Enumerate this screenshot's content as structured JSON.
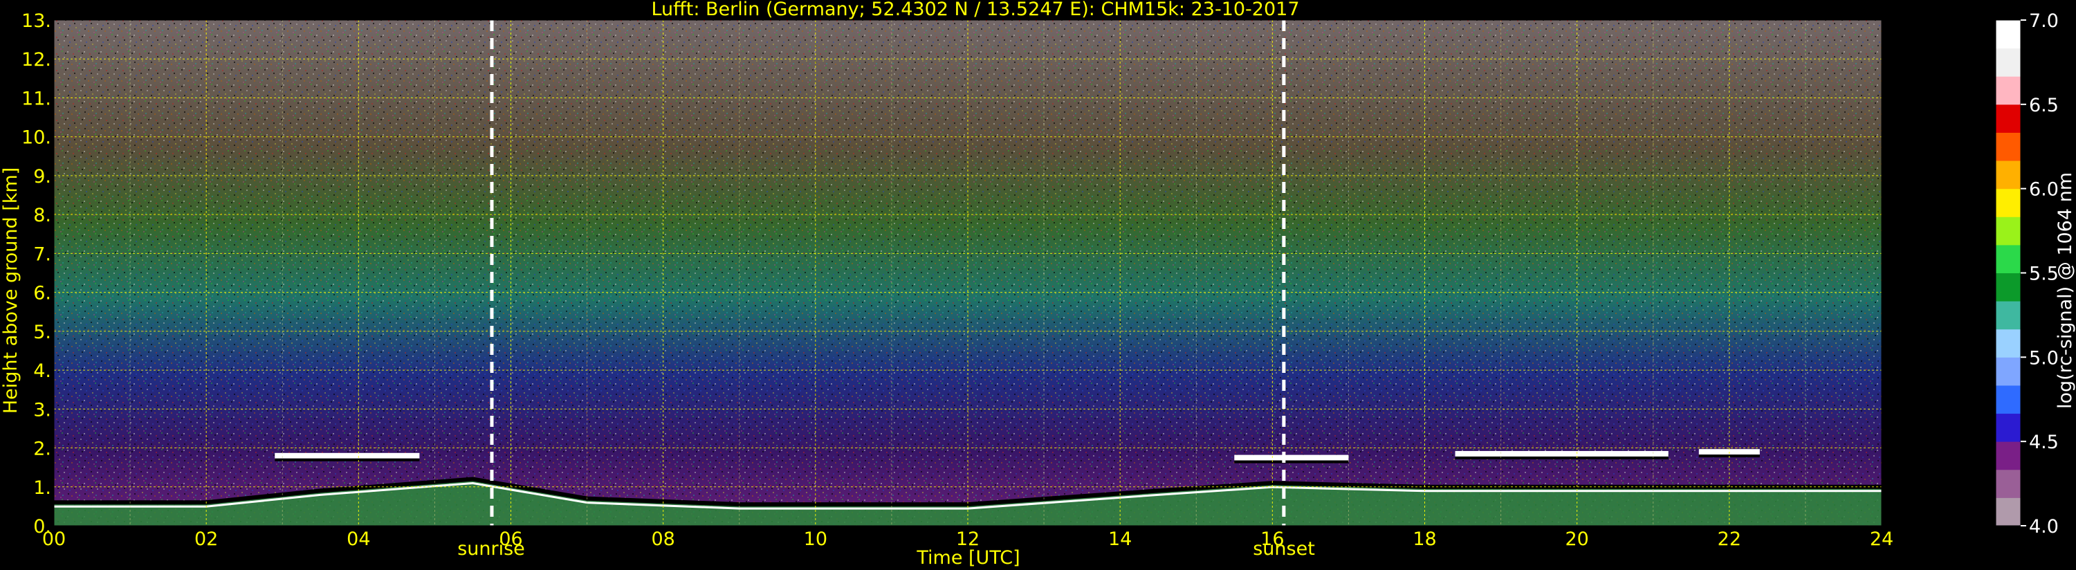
{
  "chart_data": {
    "type": "heatmap",
    "title": "Lufft: Berlin (Germany; 52.4302 N / 13.5247 E):    CHM15k: 23-10-2017",
    "xlabel": "Time [UTC]",
    "ylabel": "Height above ground [km]",
    "colorbar_label": "log(rc-signal) @ 1064 nm",
    "xlim": [
      0,
      24
    ],
    "ylim": [
      0,
      13
    ],
    "x_ticks": [
      "00",
      "02",
      "04",
      "06",
      "08",
      "10",
      "12",
      "14",
      "16",
      "18",
      "20",
      "22",
      "24"
    ],
    "y_ticks": [
      "0.",
      "1.",
      "2.",
      "3.",
      "4.",
      "5.",
      "6.",
      "7.",
      "8.",
      "9.",
      "10.",
      "11.",
      "12.",
      "13."
    ],
    "colorbar_range": [
      4.0,
      7.0
    ],
    "colorbar_ticks": [
      "4.0",
      "4.5",
      "5.0",
      "5.5",
      "6.0",
      "6.5",
      "7.0"
    ],
    "colorbar_colors": [
      "#b09aab",
      "#9a5f97",
      "#7a1f87",
      "#2b1bd1",
      "#2f6bff",
      "#7fa6ff",
      "#9ad1ff",
      "#3fb8a0",
      "#0c9a2a",
      "#2bd94a",
      "#9af21a",
      "#ffee00",
      "#ffb000",
      "#ff5a00",
      "#e00000",
      "#ffb6c1",
      "#f0f0f0",
      "#ffffff"
    ],
    "grid": true,
    "sunrise": {
      "label": "sunrise",
      "time_utc": 5.75
    },
    "sunset": {
      "label": "sunset",
      "time_utc": 16.15
    },
    "cloud_layers": [
      {
        "start": 2.9,
        "end": 4.8,
        "height_km": 1.8
      },
      {
        "start": 15.5,
        "end": 17.0,
        "height_km": 1.75
      },
      {
        "start": 18.4,
        "end": 21.2,
        "height_km": 1.85
      },
      {
        "start": 21.6,
        "end": 22.4,
        "height_km": 1.9
      }
    ],
    "boundary_layer_top": [
      {
        "t": 0,
        "h": 0.6
      },
      {
        "t": 2,
        "h": 0.6
      },
      {
        "t": 3.5,
        "h": 0.9
      },
      {
        "t": 5.5,
        "h": 1.2
      },
      {
        "t": 7,
        "h": 0.7
      },
      {
        "t": 9,
        "h": 0.55
      },
      {
        "t": 12,
        "h": 0.55
      },
      {
        "t": 14.5,
        "h": 0.9
      },
      {
        "t": 16,
        "h": 1.1
      },
      {
        "t": 18,
        "h": 1.0
      },
      {
        "t": 24,
        "h": 1.0
      }
    ]
  }
}
